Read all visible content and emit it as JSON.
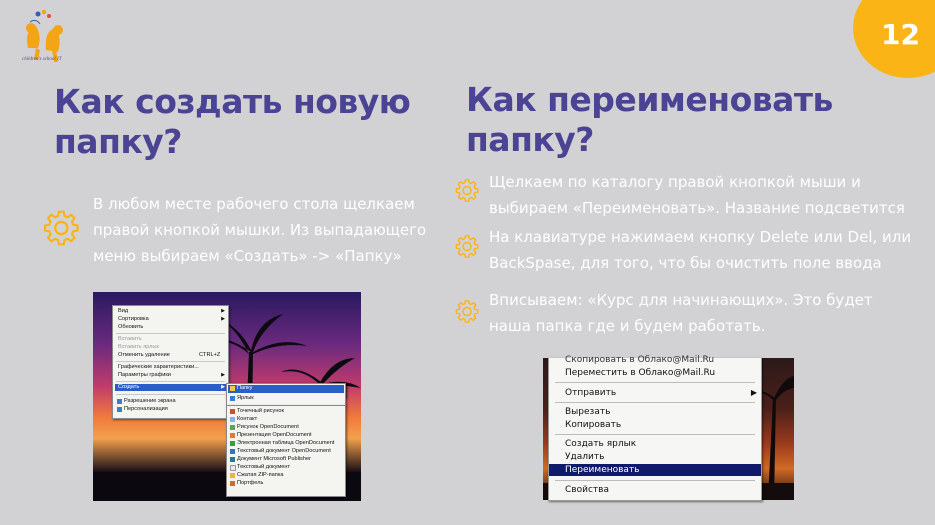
{
  "logo": {
    "caption": "children's school IT"
  },
  "page_number": "12",
  "left": {
    "title_line1": "Как создать новую",
    "title_line2": "папку?",
    "text_lines": [
      "В любом месте рабочего стола щелкаем",
      "правой кнопкой мышки. Из выпадающего",
      "меню выбираем «Создать» -> «Папку»"
    ]
  },
  "right": {
    "title_line1": "Как переименовать",
    "title_line2": "папку?",
    "steps": [
      {
        "lines": [
          "Щелкаем по каталогу правой кнопкой мыши и",
          "выбираем «Переименовать». Название подсветится"
        ]
      },
      {
        "lines": [
          "На клавиатуре нажимаем кнопку Delete или Del, или",
          "BackSpase, для того, что бы очистить поле ввода"
        ]
      },
      {
        "lines": [
          "Вписываем: «Курс для начинающих». Это будет",
          "наша папка где и будем работать."
        ]
      }
    ]
  },
  "desktop_menu": {
    "items": [
      "Вид",
      "Сортировка",
      "Обновить",
      "Вставить",
      "Вставить ярлык",
      "Отменить удаление",
      "CTRL+Z",
      "Графические характеристики...",
      "Параметры графики",
      "Создать",
      "Разрешение экрана",
      "Персонализация"
    ],
    "new_submenu_top": [
      "Папку",
      "Ярлык"
    ],
    "new_submenu": [
      "Точечный рисунок",
      "Контакт",
      "Рисунок OpenDocument",
      "Презентация OpenDocument",
      "Электронная таблица OpenDocument",
      "Текстовый документ OpenDocument",
      "Документ Microsoft Publisher",
      "Текстовый документ",
      "Сжатая ZIP-папка",
      "Портфель"
    ]
  },
  "folder_menu": {
    "items": [
      "Скопировать в Облако@Mail.Ru",
      "Переместить в Облако@Mail.Ru",
      "Отправить",
      "Вырезать",
      "Копировать",
      "Создать ярлык",
      "Удалить",
      "Переименовать",
      "Свойства"
    ]
  },
  "colors": {
    "title": "#4b4495",
    "accent": "#fbb416",
    "background": "#d2d1d3",
    "text": "#ffffff",
    "menu_highlight": "#0f1b6a"
  },
  "icons": [
    "logo-kids",
    "gear-icon"
  ]
}
